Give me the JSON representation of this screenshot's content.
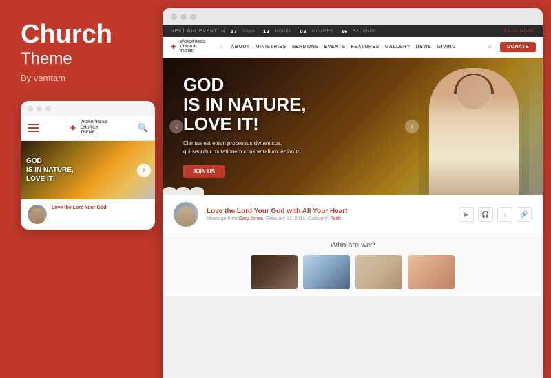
{
  "left": {
    "title_main": "Church",
    "title_sub": "Theme",
    "by": "By vamtam"
  },
  "mobile": {
    "top_dots": [
      "dot1",
      "dot2",
      "dot3"
    ],
    "logo_text": "WORDPRESS\nCHURCH\nTHEME",
    "hero_text_line1": "GOD",
    "hero_text_line2": "IS IN NATURE,",
    "hero_text_line3": "LOVE IT!",
    "sermon_title": "Love the Lord Your God"
  },
  "desktop": {
    "top_dots": [
      "dot1",
      "dot2",
      "dot3"
    ],
    "countdown_label": "NEXT BIG EVENT IN",
    "countdown_days": "37",
    "countdown_days_unit": "DAYS",
    "countdown_hours": "13",
    "countdown_hours_unit": "HOURS",
    "countdown_minutes": "03",
    "countdown_minutes_unit": "MINUTES",
    "countdown_seconds": "16",
    "countdown_seconds_unit": "SECONDS",
    "countdown_read_more": "Read More",
    "logo_text": "WORDPRESS\nCHURCH\nTHEME",
    "nav_items": [
      "ABOUT",
      "MINISTRIES",
      "SERMONS",
      "EVENTS",
      "FEATURES",
      "GALLERY",
      "NEWS",
      "GIVING"
    ],
    "donate_label": "Donate",
    "hero_title_line1": "GOD",
    "hero_title_line2": "IS IN NATURE,",
    "hero_title_line3": "LOVE IT!",
    "hero_subtitle": "Claritas est etiam processus dynamicus,\nqui sequitur mutationem consuetudium lectorum.",
    "hero_btn": "Join us",
    "sermon_title": "Love the Lord Your God with All Your Heart",
    "sermon_meta": "Message from Gary Jones, February 12, 2014. Category: Faith",
    "who_title": "Who are we?"
  },
  "colors": {
    "primary": "#c0392b",
    "dark": "#2a2a2a",
    "white": "#ffffff"
  }
}
